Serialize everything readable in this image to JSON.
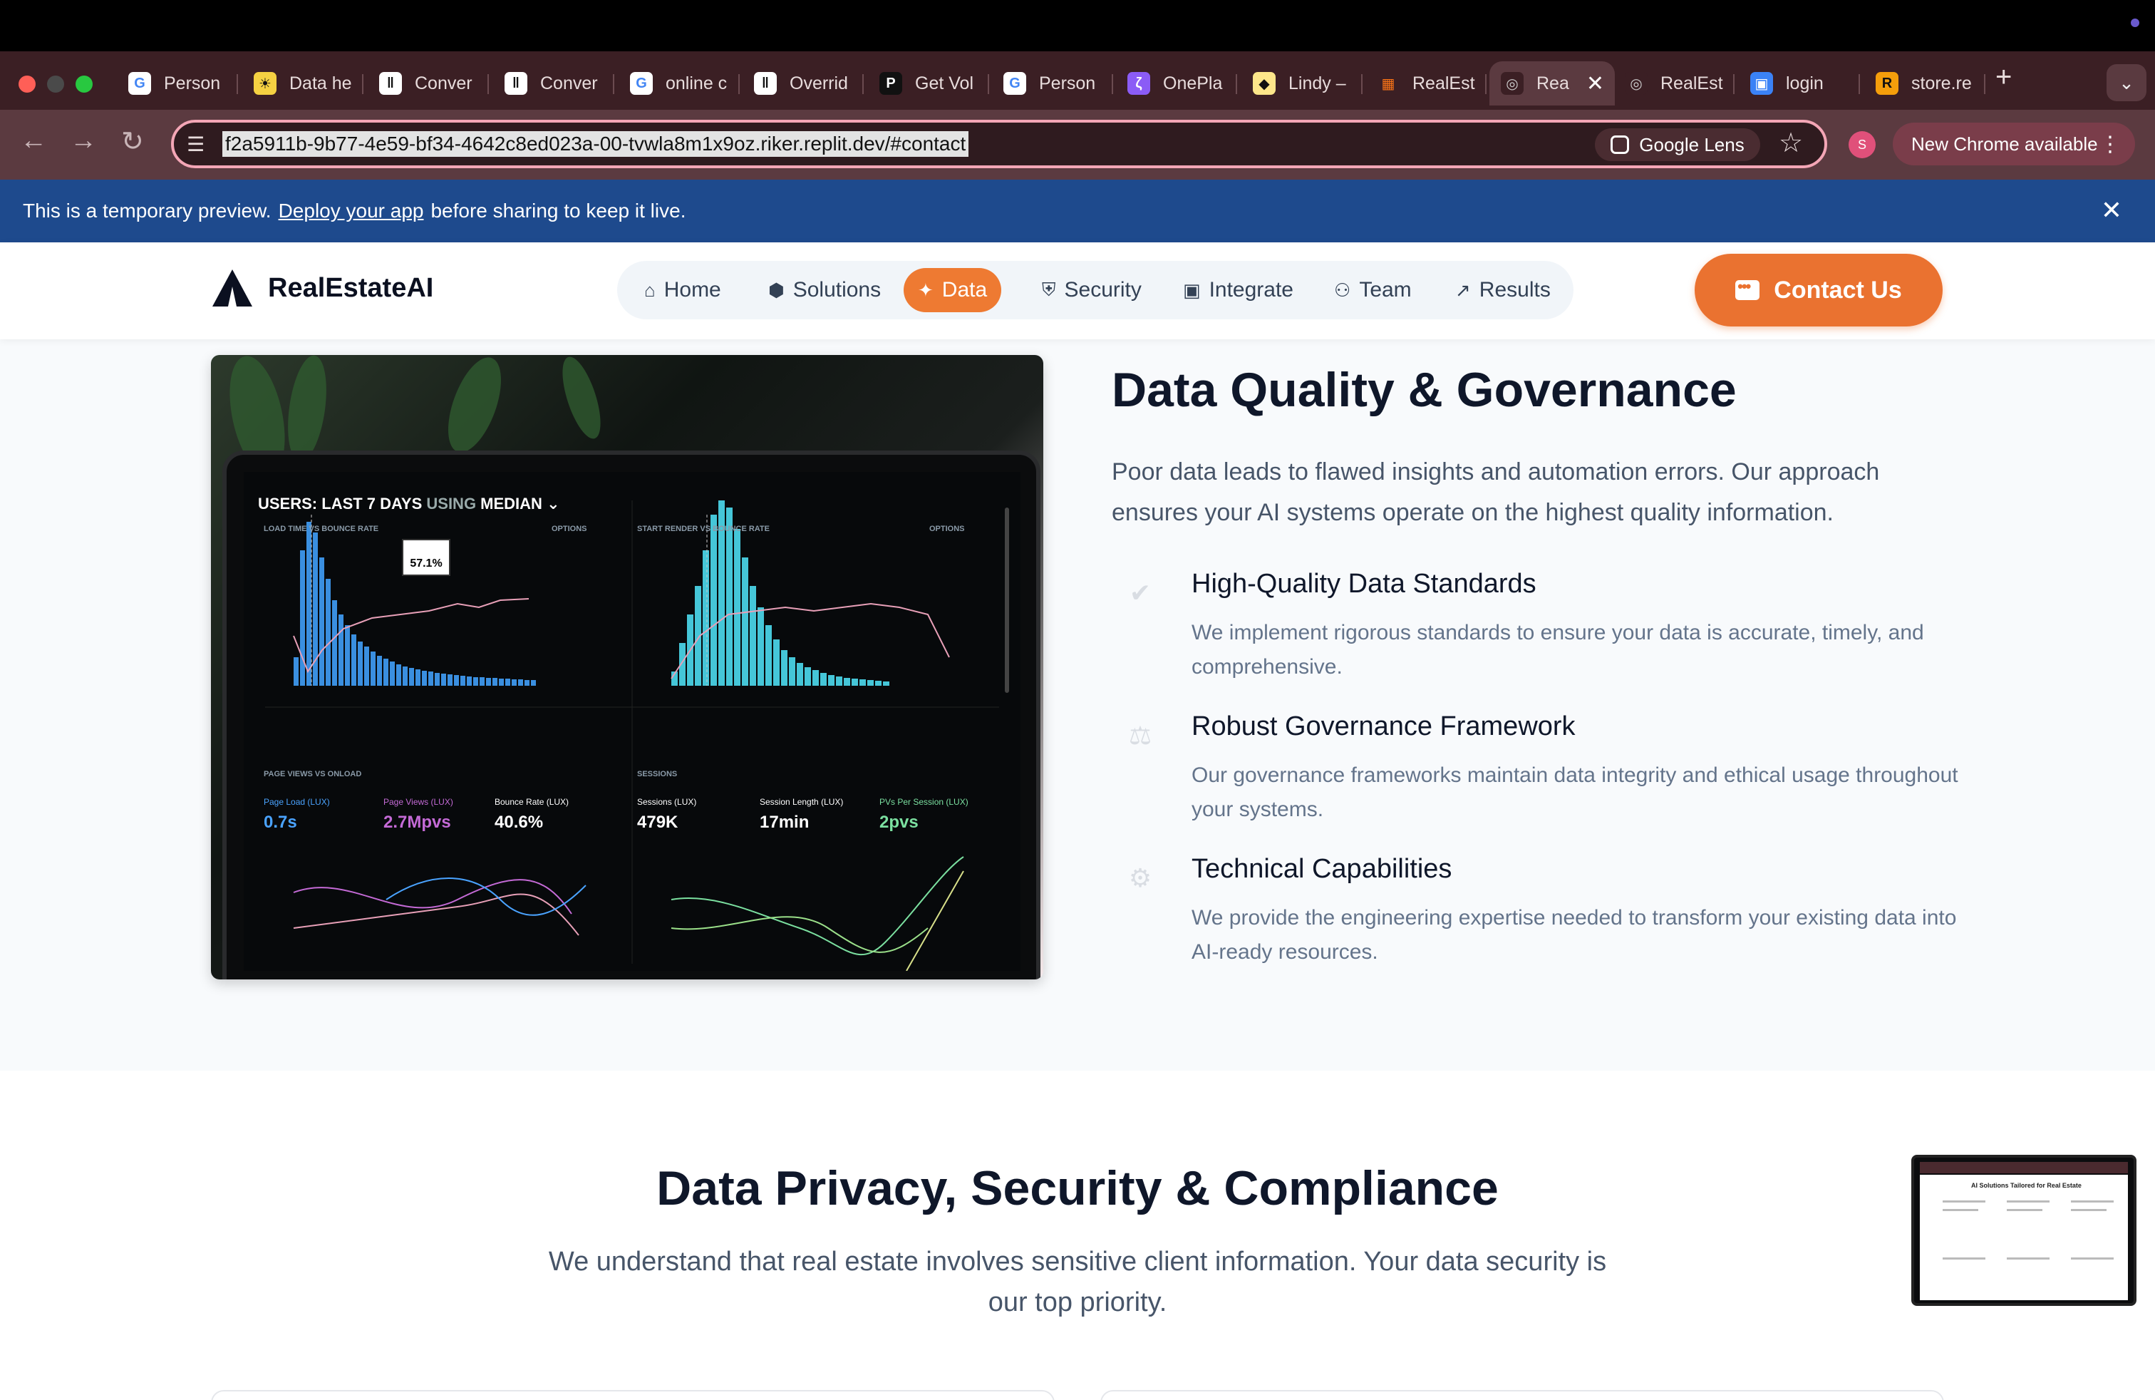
{
  "browser": {
    "tabs": [
      {
        "label": "Person",
        "icon": "google-icon"
      },
      {
        "label": "Data he",
        "icon": "sun-icon"
      },
      {
        "label": "Conver",
        "icon": "pause-icon"
      },
      {
        "label": "Conver",
        "icon": "pause-icon"
      },
      {
        "label": "online c",
        "icon": "google-icon"
      },
      {
        "label": "Overrid",
        "icon": "circle-pause-icon"
      },
      {
        "label": "Get Vol",
        "icon": "p-icon"
      },
      {
        "label": "Person",
        "icon": "google-icon"
      },
      {
        "label": "OnePla",
        "icon": "swirl-icon"
      },
      {
        "label": "Lindy –",
        "icon": "diamond-icon"
      },
      {
        "label": "RealEst",
        "icon": "grid-icon"
      },
      {
        "label": "Rea",
        "icon": "globe-icon",
        "active": true
      },
      {
        "label": "RealEst",
        "icon": "globe-icon"
      },
      {
        "label": "login",
        "icon": "blocks-icon"
      },
      {
        "label": "store.re",
        "icon": "r-icon"
      }
    ],
    "new_tab": "+",
    "url": "f2a5911b-9b77-4e59-bf34-4642c8ed023a-00-tvwla8m1x9oz.riker.replit.dev/#contact",
    "lens_label": "Google Lens",
    "profile_initial": "S",
    "update_label": "New Chrome available"
  },
  "banner": {
    "before": "This is a temporary preview.",
    "link": "Deploy your app",
    "after": "before sharing to keep it live."
  },
  "header": {
    "brand": "RealEstateAI",
    "nav": [
      {
        "label": "Home",
        "icon": "home-icon"
      },
      {
        "label": "Solutions",
        "icon": "cube-icon"
      },
      {
        "label": "Data",
        "icon": "sparkle-icon",
        "active": true
      },
      {
        "label": "Security",
        "icon": "shield-icon"
      },
      {
        "label": "Integrate",
        "icon": "chip-icon"
      },
      {
        "label": "Team",
        "icon": "users-icon"
      },
      {
        "label": "Results",
        "icon": "trend-up-icon"
      }
    ],
    "cta": "Contact Us"
  },
  "dashboard": {
    "title_a": "USERS: ",
    "title_b": "LAST 7 DAYS",
    "title_c": " USING ",
    "title_d": "MEDIAN",
    "panel1": "LOAD TIME VS BOUNCE RATE",
    "panel2": "START RENDER VS BOUNCE RATE",
    "panel3": "PAGE VIEWS VS ONLOAD",
    "panel4": "SESSIONS",
    "options": "OPTIONS",
    "tooltip": "57.1%",
    "metrics": [
      {
        "label": "Page Load (LUX)",
        "value": "0.7s",
        "color": "#4aa3ff"
      },
      {
        "label": "Page Views (LUX)",
        "value": "2.7Mpvs",
        "color": "#c46ad6"
      },
      {
        "label": "Bounce Rate (LUX)",
        "value": "40.6%",
        "color": "#ffffff"
      },
      {
        "label": "Sessions (LUX)",
        "value": "479K",
        "color": "#ffffff"
      },
      {
        "label": "Session Length (LUX)",
        "value": "17min",
        "color": "#ffffff"
      },
      {
        "label": "PVs Per Session (LUX)",
        "value": "2pvs",
        "color": "#7be0a0"
      }
    ]
  },
  "data_section": {
    "title": "Data Quality & Governance",
    "intro": "Poor data leads to flawed insights and automation errors. Our approach ensures your AI systems operate on the highest quality information.",
    "features": [
      {
        "icon": "check-circle-icon",
        "title": "High-Quality Data Standards",
        "desc": "We implement rigorous standards to ensure your data is accurate, timely, and comprehensive."
      },
      {
        "icon": "scale-icon",
        "title": "Robust Governance Framework",
        "desc": "Our governance frameworks maintain data integrity and ethical usage throughout your systems."
      },
      {
        "icon": "gear-icon",
        "title": "Technical Capabilities",
        "desc": "We provide the engineering expertise needed to transform your existing data into AI-ready resources."
      }
    ]
  },
  "privacy_section": {
    "title": "Data Privacy, Security & Compliance",
    "subtitle": "We understand that real estate involves sensitive client information. Your data security is our top priority."
  },
  "pip": {
    "title": "AI Solutions Tailored for Real Estate"
  }
}
